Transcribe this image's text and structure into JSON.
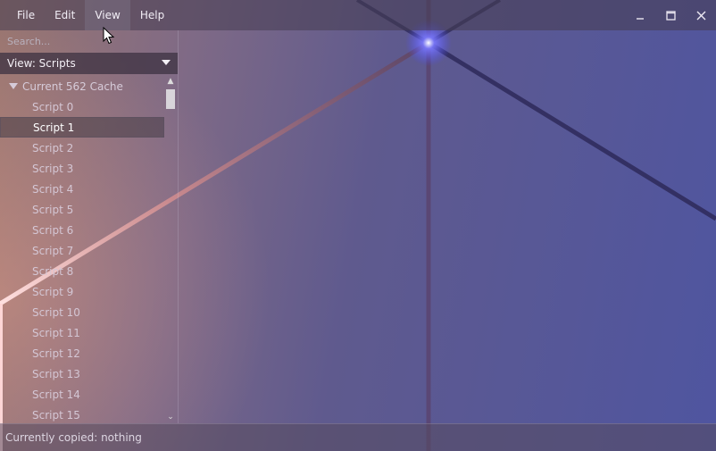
{
  "menu": {
    "items": [
      {
        "label": "File"
      },
      {
        "label": "Edit"
      },
      {
        "label": "View"
      },
      {
        "label": "Help"
      }
    ],
    "active_index": 2
  },
  "window_controls": {
    "minimize_icon": "minimize-icon",
    "maximize_icon": "maximize-icon",
    "close_icon": "close-icon"
  },
  "sidebar": {
    "search_placeholder": "Search...",
    "view_select_value": "View: Scripts",
    "tree": {
      "root_label": "Current 562 Cache",
      "selected_index": 1,
      "items": [
        {
          "label": "Script 0"
        },
        {
          "label": "Script 1"
        },
        {
          "label": "Script 2"
        },
        {
          "label": "Script 3"
        },
        {
          "label": "Script 4"
        },
        {
          "label": "Script 5"
        },
        {
          "label": "Script 6"
        },
        {
          "label": "Script 7"
        },
        {
          "label": "Script 8"
        },
        {
          "label": "Script 9"
        },
        {
          "label": "Script 10"
        },
        {
          "label": "Script 11"
        },
        {
          "label": "Script 12"
        },
        {
          "label": "Script 13"
        },
        {
          "label": "Script 14"
        },
        {
          "label": "Script 15"
        }
      ]
    }
  },
  "status": {
    "text": "Currently copied: nothing"
  },
  "colors": {
    "gradient_left": "#9a7670",
    "gradient_right": "#4f55a0",
    "glow": "#6f6cff"
  }
}
